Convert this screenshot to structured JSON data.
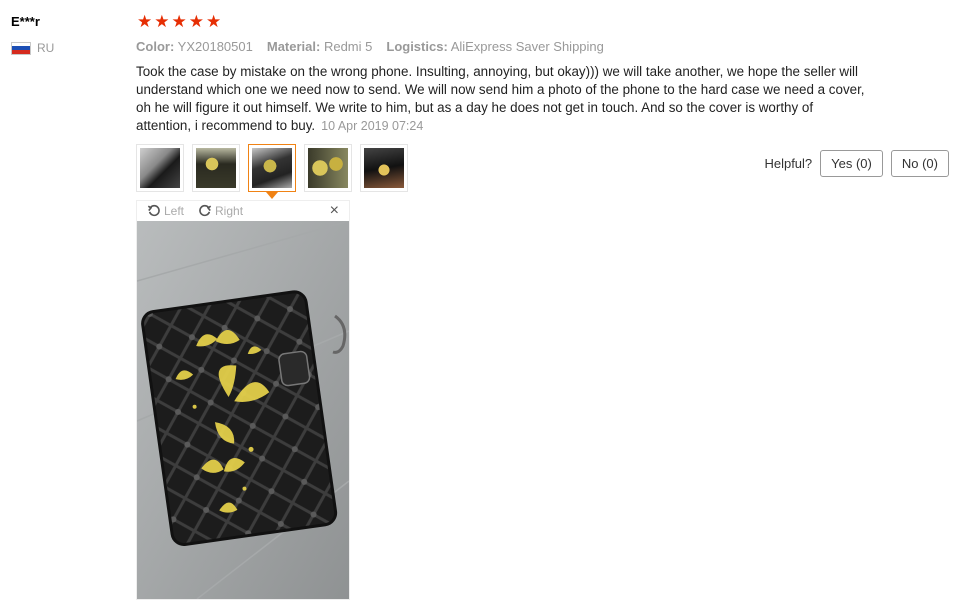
{
  "reviewer": {
    "name": "E***r",
    "country": "RU"
  },
  "rating": 5,
  "attributes": {
    "color_label": "Color:",
    "color_value": "YX20180501",
    "material_label": "Material:",
    "material_value": "Redmi 5",
    "logistics_label": "Logistics:",
    "logistics_value": "AliExpress Saver Shipping"
  },
  "review": {
    "text": "Took the case by mistake on the wrong phone. Insulting, annoying, but okay))) we will take another, we hope the seller will understand which one we need now to send. We will now send him a photo of the phone to the hard case we need a cover, oh he will figure it out himself. We write to him, but as a day he does not get in touch. And so the cover is worthy of attention, i recommend to buy.",
    "date": "10 Apr 2019 07:24"
  },
  "thumbnails": [
    {
      "name": "photo-1",
      "active": false
    },
    {
      "name": "photo-2",
      "active": false
    },
    {
      "name": "photo-3",
      "active": true
    },
    {
      "name": "photo-4",
      "active": false
    },
    {
      "name": "photo-5",
      "active": false
    }
  ],
  "helpful": {
    "label": "Helpful?",
    "yes": "Yes (0)",
    "no": "No (0)"
  },
  "viewer": {
    "rotate_left": "Left",
    "rotate_right": "Right",
    "close": "×"
  },
  "colors": {
    "star": "#e62e04",
    "active_thumb": "#f08214"
  },
  "icons": {
    "close": "close-icon",
    "rotate_left": "rotate-left-icon",
    "rotate_right": "rotate-right-icon",
    "star": "star-icon",
    "flag": "flag-icon"
  }
}
